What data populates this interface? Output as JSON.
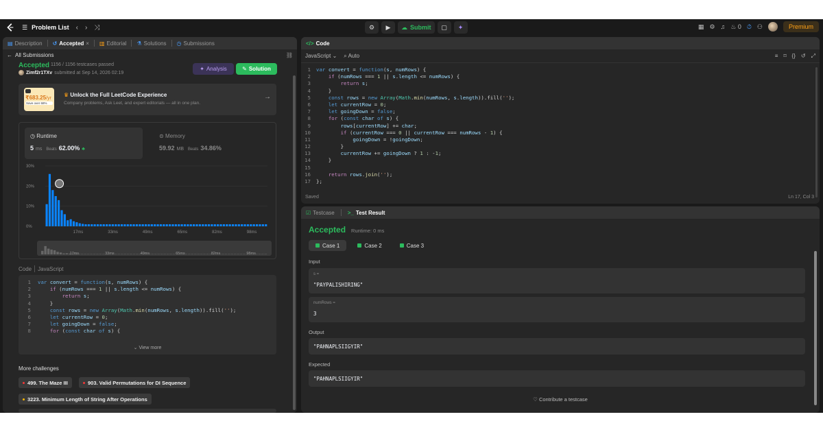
{
  "topbar": {
    "problem_list": "Problem List",
    "submit": "Submit",
    "fire_count": "0",
    "premium": "Premium"
  },
  "left": {
    "tabs": [
      {
        "label": "Description"
      },
      {
        "label": "Accepted"
      },
      {
        "label": "Editorial"
      },
      {
        "label": "Solutions"
      },
      {
        "label": "Submissions"
      }
    ],
    "back_label": "All Submissions",
    "status": "Accepted",
    "testcases": "1156 / 1156 testcases passed",
    "user": "Zimf2r1TXv",
    "submitted": "submitted at Sep 14, 2026 02:19",
    "analysis_btn": "Analysis",
    "solution_btn": "Solution",
    "promo": {
      "price": "₹683.25",
      "per": "/yr",
      "save": "Save over 68%",
      "title": "Unlock the Full LeetCode Experience",
      "desc": "Company problems, Ask Leet, and expert editorials — all in one plan."
    },
    "runtime": {
      "label": "Runtime",
      "value": "5",
      "unit": "ms",
      "beats_label": "Beats",
      "beats": "62.00%"
    },
    "memory": {
      "label": "Memory",
      "value": "59.92",
      "unit": "MB",
      "beats_label": "Beats",
      "beats": "34.86%"
    },
    "code_header": {
      "label": "Code",
      "lang": "JavaScript"
    },
    "view_more": "View more",
    "more_title": "More challenges",
    "challenges": [
      "499. The Maze III",
      "903. Valid Permutations for DI Sequence",
      "3223. Minimum Length of String After Operations"
    ]
  },
  "chart_data": {
    "type": "bar",
    "yticks": [
      "30%",
      "20%",
      "10%",
      "0%"
    ],
    "xticks": [
      "17ms",
      "33ms",
      "49ms",
      "65ms",
      "82ms",
      "98ms"
    ],
    "ylim": [
      0,
      30
    ],
    "values": [
      11,
      26,
      18,
      15,
      13,
      8,
      6,
      3,
      3.5,
      2.5,
      2,
      1.5,
      1.2,
      1,
      1,
      1,
      1,
      1,
      1,
      1,
      1,
      1,
      1,
      1,
      1,
      1,
      1,
      1,
      1,
      1,
      1,
      1,
      1,
      1,
      1,
      1,
      1,
      1,
      1,
      1,
      1,
      1,
      1,
      1,
      1,
      1,
      1,
      1,
      1,
      1,
      1,
      1,
      1,
      1,
      1,
      1,
      1,
      1,
      1,
      1,
      1,
      1,
      1,
      1,
      1,
      1,
      1,
      1,
      1,
      1,
      1,
      1,
      1,
      1
    ],
    "highlight_index": 4,
    "mini_xticks": [
      "17ms",
      "33ms",
      "49ms",
      "65ms",
      "82ms",
      "98ms"
    ]
  },
  "code_panel": {
    "title": "Code",
    "lang": "JavaScript",
    "auto": "Auto",
    "status_left": "Saved",
    "status_right": "Ln 17, Col 3"
  },
  "code_lines": [
    [
      [
        "kw",
        "var "
      ],
      [
        "vr",
        "convert"
      ],
      [
        "pu",
        " = "
      ],
      [
        "kw",
        "function"
      ],
      [
        "pu",
        "("
      ],
      [
        "vr",
        "s"
      ],
      [
        "pu",
        ", "
      ],
      [
        "vr",
        "numRows"
      ],
      [
        "pu",
        ") {"
      ]
    ],
    [
      [
        "pu",
        "    "
      ],
      [
        "ctl",
        "if"
      ],
      [
        "pu",
        " ("
      ],
      [
        "vr",
        "numRows"
      ],
      [
        "pu",
        " === "
      ],
      [
        "num",
        "1"
      ],
      [
        "pu",
        " || "
      ],
      [
        "vr",
        "s"
      ],
      [
        "pu",
        "."
      ],
      [
        "vr",
        "length"
      ],
      [
        "pu",
        " <= "
      ],
      [
        "vr",
        "numRows"
      ],
      [
        "pu",
        ") {"
      ]
    ],
    [
      [
        "pu",
        "        "
      ],
      [
        "ctl",
        "return"
      ],
      [
        "pu",
        " "
      ],
      [
        "vr",
        "s"
      ],
      [
        "pu",
        ";"
      ]
    ],
    [
      [
        "pu",
        "    }"
      ]
    ],
    [
      [
        "pu",
        "    "
      ],
      [
        "kw",
        "const"
      ],
      [
        "pu",
        " "
      ],
      [
        "vr",
        "rows"
      ],
      [
        "pu",
        " = "
      ],
      [
        "kw",
        "new"
      ],
      [
        "pu",
        " "
      ],
      [
        "cls",
        "Array"
      ],
      [
        "pu",
        "("
      ],
      [
        "cls",
        "Math"
      ],
      [
        "pu",
        "."
      ],
      [
        "fn",
        "min"
      ],
      [
        "pu",
        "("
      ],
      [
        "vr",
        "numRows"
      ],
      [
        "pu",
        ", "
      ],
      [
        "vr",
        "s"
      ],
      [
        "pu",
        "."
      ],
      [
        "vr",
        "length"
      ],
      [
        "pu",
        ")).fill("
      ],
      [
        "str",
        "''"
      ],
      [
        "pu",
        ");"
      ]
    ],
    [
      [
        "pu",
        "    "
      ],
      [
        "kw",
        "let"
      ],
      [
        "pu",
        " "
      ],
      [
        "vr",
        "currentRow"
      ],
      [
        "pu",
        " = "
      ],
      [
        "num",
        "0"
      ],
      [
        "pu",
        ";"
      ]
    ],
    [
      [
        "pu",
        "    "
      ],
      [
        "kw",
        "let"
      ],
      [
        "pu",
        " "
      ],
      [
        "vr",
        "goingDown"
      ],
      [
        "pu",
        " = "
      ],
      [
        "kw",
        "false"
      ],
      [
        "pu",
        ";"
      ]
    ],
    [
      [
        "pu",
        "    "
      ],
      [
        "ctl",
        "for"
      ],
      [
        "pu",
        " ("
      ],
      [
        "kw",
        "const"
      ],
      [
        "pu",
        " "
      ],
      [
        "vr",
        "char"
      ],
      [
        "pu",
        " "
      ],
      [
        "kw",
        "of"
      ],
      [
        "pu",
        " "
      ],
      [
        "vr",
        "s"
      ],
      [
        "pu",
        ") {"
      ]
    ],
    [
      [
        "pu",
        "        "
      ],
      [
        "vr",
        "rows"
      ],
      [
        "pu",
        "["
      ],
      [
        "vr",
        "currentRow"
      ],
      [
        "pu",
        "] += "
      ],
      [
        "vr",
        "char"
      ],
      [
        "pu",
        ";"
      ]
    ],
    [
      [
        "pu",
        "        "
      ],
      [
        "ctl",
        "if"
      ],
      [
        "pu",
        " ("
      ],
      [
        "vr",
        "currentRow"
      ],
      [
        "pu",
        " === "
      ],
      [
        "num",
        "0"
      ],
      [
        "pu",
        " || "
      ],
      [
        "vr",
        "currentRow"
      ],
      [
        "pu",
        " === "
      ],
      [
        "vr",
        "numRows"
      ],
      [
        "pu",
        " - "
      ],
      [
        "num",
        "1"
      ],
      [
        "pu",
        ") {"
      ]
    ],
    [
      [
        "pu",
        "            "
      ],
      [
        "vr",
        "goingDown"
      ],
      [
        "pu",
        " = !"
      ],
      [
        "vr",
        "goingDown"
      ],
      [
        "pu",
        ";"
      ]
    ],
    [
      [
        "pu",
        "        }"
      ]
    ],
    [
      [
        "pu",
        "        "
      ],
      [
        "vr",
        "currentRow"
      ],
      [
        "pu",
        " += "
      ],
      [
        "vr",
        "goingDown"
      ],
      [
        "pu",
        " ? "
      ],
      [
        "num",
        "1"
      ],
      [
        "pu",
        " : -"
      ],
      [
        "num",
        "1"
      ],
      [
        "pu",
        ";"
      ]
    ],
    [
      [
        "pu",
        "    }"
      ]
    ],
    [
      [
        "pu",
        ""
      ]
    ],
    [
      [
        "pu",
        "    "
      ],
      [
        "ctl",
        "return"
      ],
      [
        "pu",
        " "
      ],
      [
        "vr",
        "rows"
      ],
      [
        "pu",
        "."
      ],
      [
        "fn",
        "join"
      ],
      [
        "pu",
        "("
      ],
      [
        "str",
        "''"
      ],
      [
        "pu",
        ");"
      ]
    ],
    [
      [
        "pu",
        "};"
      ]
    ]
  ],
  "test": {
    "tab_testcase": "Testcase",
    "tab_result": "Test Result",
    "status": "Accepted",
    "runtime": "Runtime: 0 ms",
    "cases": [
      "Case 1",
      "Case 2",
      "Case 3"
    ],
    "input_label": "Input",
    "s_label": "s =",
    "s_value": "\"PAYPALISHIRING\"",
    "numrows_label": "numRows =",
    "numrows_value": "3",
    "output_label": "Output",
    "output_value": "\"PAHNAPLSIIGYIR\"",
    "expected_label": "Expected",
    "expected_value": "\"PAHNAPLSIIGYIR\"",
    "contribute": "Contribute a testcase"
  }
}
